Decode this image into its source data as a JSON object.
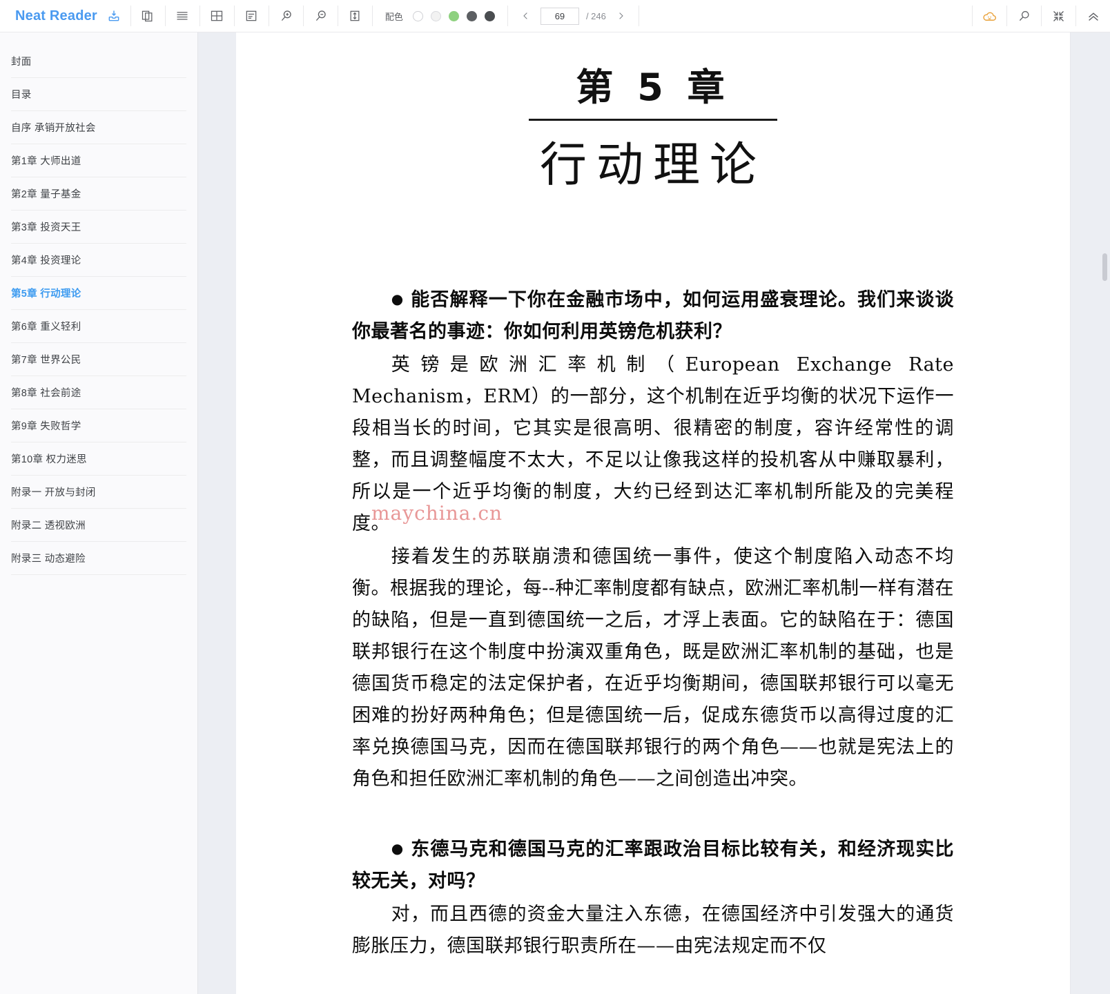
{
  "app": {
    "brand": "Neat Reader",
    "brand_color": "#4a9af0",
    "save_icon": "save-to-library-icon"
  },
  "toolbar": {
    "tools": [
      {
        "name": "two-page-view-icon",
        "label": "双页视图"
      },
      {
        "name": "line-spacing-icon",
        "label": "行间距"
      },
      {
        "name": "page-margin-icon",
        "label": "页边距"
      },
      {
        "name": "text-align-icon",
        "label": "文字排版"
      },
      {
        "name": "zoom-in-icon",
        "label": "放大"
      },
      {
        "name": "zoom-out-icon",
        "label": "缩小"
      },
      {
        "name": "line-height-icon",
        "label": "行高"
      }
    ],
    "theme": {
      "label": "配色",
      "swatches": [
        {
          "name": "theme-white",
          "color": "#ffffff",
          "border": "#cfd0d4",
          "selected": false
        },
        {
          "name": "theme-light-gray",
          "color": "#f0f0f0",
          "border": "#d8d9dd",
          "selected": false
        },
        {
          "name": "theme-green",
          "color": "#8ed17f",
          "border": "#8ed17f",
          "selected": true
        },
        {
          "name": "theme-dark-gray",
          "color": "#5c5f62",
          "border": "#5c5f62",
          "selected": false
        },
        {
          "name": "theme-black",
          "color": "#4a4d50",
          "border": "#4a4d50",
          "selected": false
        }
      ]
    },
    "pager": {
      "prev": "‹",
      "next": "›",
      "current_page": "69",
      "total_label": "/ 246",
      "placeholder": "69"
    },
    "right_tools": [
      {
        "name": "cloud-sync-icon",
        "label": "云同步",
        "color": "#e9a23b"
      },
      {
        "name": "search-icon",
        "label": "搜索"
      },
      {
        "name": "exit-fullscreen-icon",
        "label": "退出全屏"
      },
      {
        "name": "collapse-toolbar-icon",
        "label": "收起工具栏"
      }
    ]
  },
  "sidebar": {
    "items": [
      {
        "label": "封面",
        "active": false
      },
      {
        "label": "目录",
        "active": false
      },
      {
        "label": "自序 承销开放社会",
        "active": false
      },
      {
        "label": "第1章 大师出道",
        "active": false
      },
      {
        "label": "第2章 量子基金",
        "active": false
      },
      {
        "label": "第3章 投资天王",
        "active": false
      },
      {
        "label": "第4章 投资理论",
        "active": false
      },
      {
        "label": "第5章 行动理论",
        "active": true
      },
      {
        "label": "第6章 重义轻利",
        "active": false
      },
      {
        "label": "第7章 世界公民",
        "active": false
      },
      {
        "label": "第8章 社会前途",
        "active": false
      },
      {
        "label": "第9章 失败哲学",
        "active": false
      },
      {
        "label": "第10章 权力迷思",
        "active": false
      },
      {
        "label": "附录一 开放与封闭",
        "active": false
      },
      {
        "label": "附录二 透视欧洲",
        "active": false
      },
      {
        "label": "附录三 动态避险",
        "active": false
      }
    ]
  },
  "content": {
    "chapter_number": "第 5 章",
    "chapter_title": "行动理论",
    "watermark": "maychina.cn",
    "paragraphs": [
      {
        "kind": "question",
        "bullet": "●",
        "text": "能否解释一下你在金融市场中，如何运用盛衰理论。我们来谈谈你最著名的事迹：你如何利用英镑危机获利？"
      },
      {
        "kind": "answer",
        "text": "英镑是欧洲汇率机制（European Exchange Rate Mechanism，ERM）的一部分，这个机制在近乎均衡的状况下运作一段相当长的时间，它其实是很高明、很精密的制度，容许经常性的调整，而且调整幅度不太大，不足以让像我这样的投机客从中赚取暴利，所以是一个近乎均衡的制度，大约已经到达汇率机制所能及的完美程度。"
      },
      {
        "kind": "answer",
        "text": "接着发生的苏联崩溃和德国统一事件，使这个制度陷入动态不均衡。根据我的理论，每--种汇率制度都有缺点，欧洲汇率机制一样有潜在的缺陷，但是一直到德国统一之后，才浮上表面。它的缺陷在于：德国联邦银行在这个制度中扮演双重角色，既是欧洲汇率机制的基础，也是德国货币稳定的法定保护者，在近乎均衡期间，德国联邦银行可以毫无困难的扮好两种角色；但是德国统一后，促成东德货币以高得过度的汇率兑换德国马克，因而在德国联邦银行的两个角色——也就是宪法上的角色和担任欧洲汇率机制的角色——之间创造出冲突。"
      },
      {
        "kind": "question",
        "bullet": "●",
        "spaced": true,
        "text": "东德马克和德国马克的汇率跟政治目标比较有关，和经济现实比较无关，对吗？"
      },
      {
        "kind": "answer",
        "text": "对，而且西德的资金大量注入东德，在德国经济中引发强大的通货膨胀压力，德国联邦银行职责所在——由宪法规定而不仅"
      }
    ]
  }
}
